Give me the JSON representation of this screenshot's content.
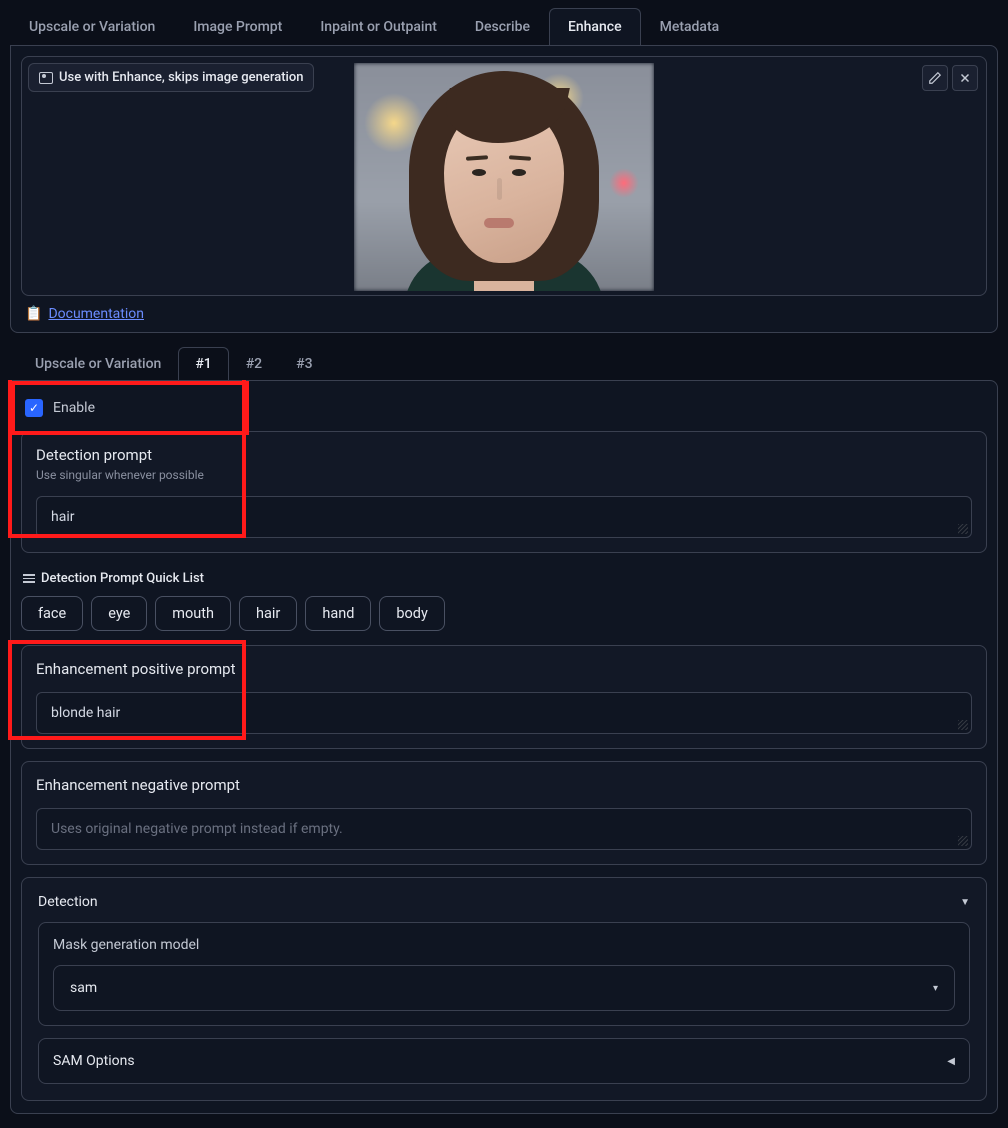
{
  "tabs": {
    "upscale": "Upscale or Variation",
    "image_prompt": "Image Prompt",
    "inpaint": "Inpaint or Outpaint",
    "describe": "Describe",
    "enhance": "Enhance",
    "metadata": "Metadata"
  },
  "upload": {
    "banner": "Use with Enhance, skips image generation"
  },
  "documentation": {
    "label": "Documentation",
    "icon": "📋"
  },
  "subtabs": {
    "upscale": "Upscale or Variation",
    "n1": "#1",
    "n2": "#2",
    "n3": "#3"
  },
  "enable_label": "Enable",
  "detection": {
    "title": "Detection prompt",
    "subtitle": "Use singular whenever possible",
    "value": "hair"
  },
  "quicklist": {
    "title": "Detection Prompt Quick List",
    "items": [
      "face",
      "eye",
      "mouth",
      "hair",
      "hand",
      "body"
    ]
  },
  "positive": {
    "title": "Enhancement positive prompt",
    "value": "blonde hair"
  },
  "negative": {
    "title": "Enhancement negative prompt",
    "placeholder": "Uses original negative prompt instead if empty."
  },
  "detection_section": {
    "title": "Detection",
    "mask_label": "Mask generation model",
    "mask_value": "sam",
    "sam_options": "SAM Options"
  }
}
